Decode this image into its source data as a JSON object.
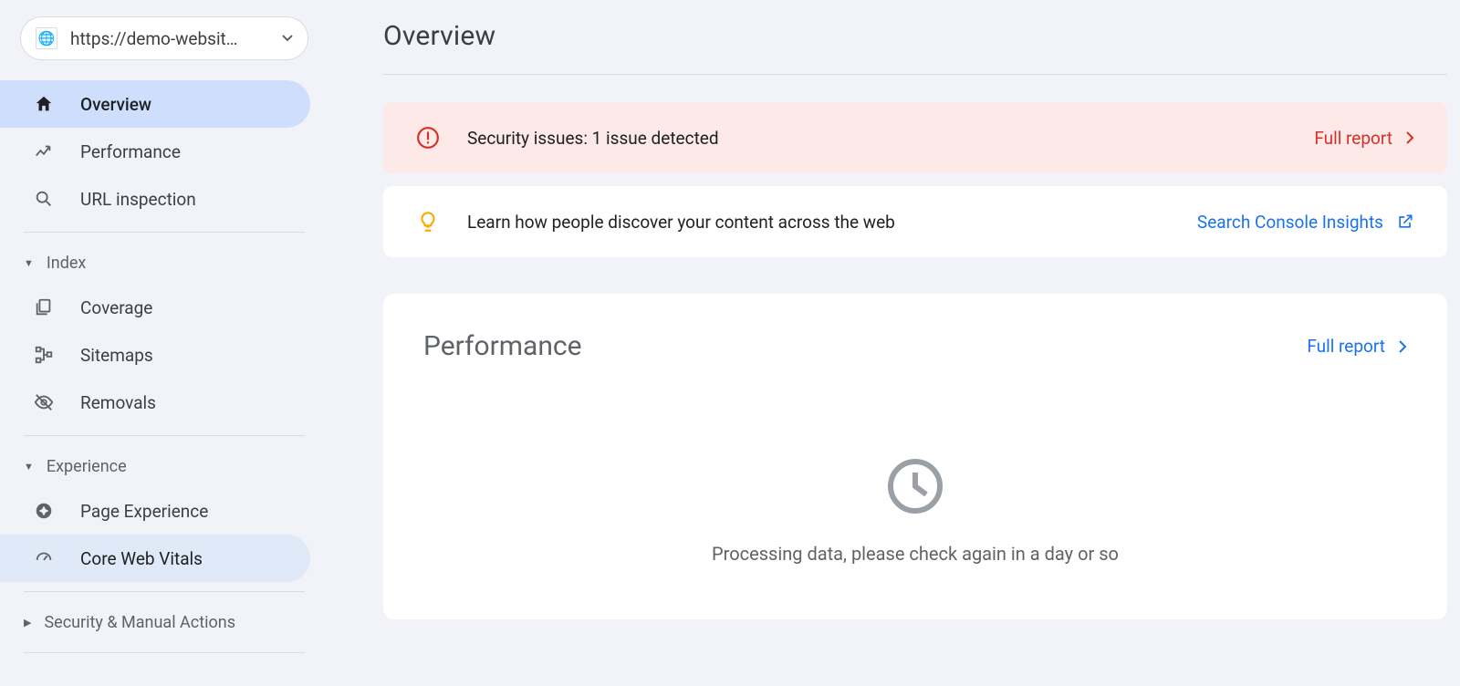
{
  "property": {
    "url": "https://demo-websit…"
  },
  "nav": {
    "overview": "Overview",
    "performance": "Performance",
    "url_inspection": "URL inspection"
  },
  "sections": {
    "index": {
      "label": "Index",
      "coverage": "Coverage",
      "sitemaps": "Sitemaps",
      "removals": "Removals"
    },
    "experience": {
      "label": "Experience",
      "page_experience": "Page Experience",
      "core_web_vitals": "Core Web Vitals"
    },
    "security": {
      "label": "Security & Manual Actions"
    }
  },
  "page": {
    "title": "Overview"
  },
  "alerts": {
    "security": {
      "message": "Security issues: 1 issue detected",
      "link": "Full report"
    },
    "insights": {
      "message": "Learn how people discover your content across the web",
      "link": "Search Console Insights"
    }
  },
  "performance_card": {
    "title": "Performance",
    "link": "Full report",
    "empty_message": "Processing data, please check again in a day or so"
  }
}
